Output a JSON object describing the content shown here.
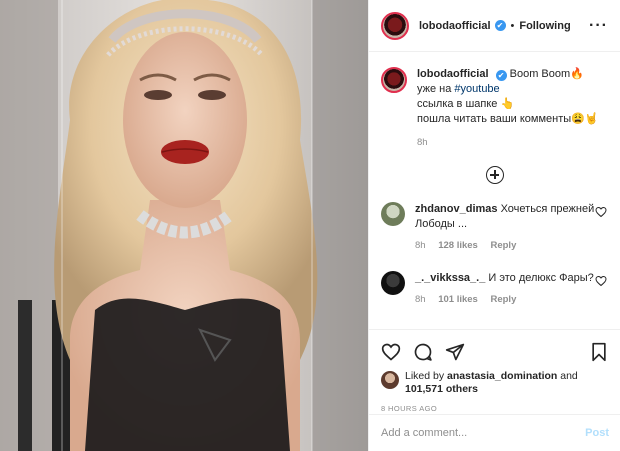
{
  "post": {
    "username": "lobodaofficial",
    "verified_mark": "✔",
    "separator": "•",
    "follow_status": "Following",
    "more_label": "···"
  },
  "caption": {
    "username": "lobodaofficial",
    "line1": "Boom Boom🔥",
    "line2_prefix": "уже на ",
    "hashtag": "#youtube",
    "line3": "ссылка в шапке 👆",
    "line4": "пошла читать ваши комменты😩🤘",
    "time": "8h"
  },
  "comments": [
    {
      "username": "zhdanov_dimas",
      "text": "Хочеться прежней Лободы ...",
      "time": "8h",
      "likes": "128 likes",
      "reply": "Reply"
    },
    {
      "username": "_._vikkssa_._",
      "text": "И это делюкс Фары?",
      "time": "8h",
      "likes": "101 likes",
      "reply": "Reply"
    }
  ],
  "likes": {
    "prefix": "Liked by ",
    "user": "anastasia_domination",
    "connector": " and",
    "count": "101,571 others"
  },
  "timestamp": "8 HOURS AGO",
  "add_comment": {
    "placeholder": "Add a comment...",
    "post_label": "Post"
  },
  "icons": [
    "more-icon",
    "plus-circle-icon",
    "heart-icon",
    "comment-icon",
    "share-icon",
    "bookmark-icon",
    "verified-icon"
  ],
  "colors": {
    "link": "#00376b",
    "verified": "#3897f0",
    "post_disabled": "#b2dffc",
    "muted": "#8e8e8e"
  }
}
